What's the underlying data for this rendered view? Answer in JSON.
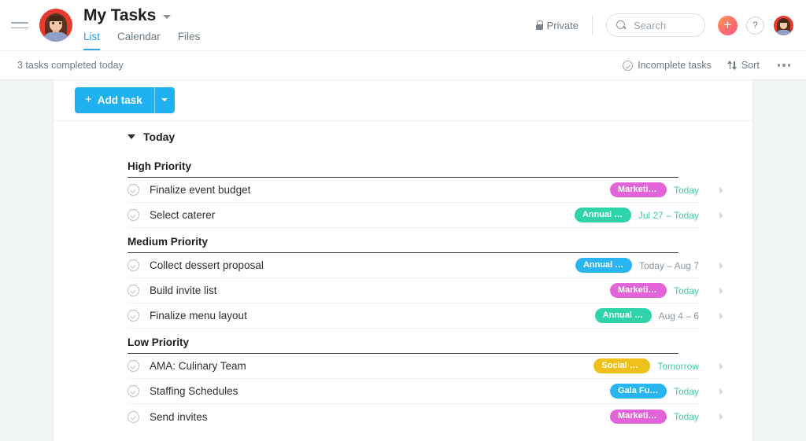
{
  "header": {
    "menu_icon": "hamburger-icon",
    "project_avatar": "project-avatar",
    "title": "My Tasks",
    "title_caret": "chevron-down-icon",
    "tabs": [
      {
        "label": "List",
        "active": true
      },
      {
        "label": "Calendar",
        "active": false
      },
      {
        "label": "Files",
        "active": false
      }
    ],
    "privacy": {
      "label": "Private",
      "icon": "lock-icon"
    },
    "search": {
      "placeholder": "Search",
      "value": "",
      "icon": "search-icon"
    },
    "add_button": {
      "label": "+",
      "icon": "plus-icon"
    },
    "help_button": {
      "label": "?",
      "icon": "question-mark-icon"
    },
    "user_avatar": "user-avatar"
  },
  "toolbar": {
    "completed_note": "3 tasks completed today",
    "filter": {
      "label": "Incomplete tasks",
      "icon": "check-circle-icon"
    },
    "sort": {
      "label": "Sort",
      "icon": "sort-arrows-icon"
    },
    "more": {
      "label": "•••",
      "icon": "more-horizontal-icon"
    }
  },
  "main": {
    "add_task": {
      "label": "Add task",
      "plus": "+",
      "dropdown_icon": "chevron-down-icon"
    },
    "group": {
      "label": "Today",
      "expanded": true,
      "toggle_icon": "triangle-down-icon"
    },
    "sections": [
      {
        "title": "High Priority",
        "tasks": [
          {
            "name": "Finalize event budget",
            "tag": "Marketin...",
            "tag_color": "#e364d8",
            "date": "Today",
            "date_color": "#3fd0a0"
          },
          {
            "name": "Select caterer",
            "tag": "Annual cu...",
            "tag_color": "#2ed3aa",
            "date": "Jul 27 – Today",
            "date_color": "#3fd0a0"
          }
        ]
      },
      {
        "title": "Medium Priority",
        "tasks": [
          {
            "name": "Collect dessert proposal",
            "tag": "Annual c...",
            "tag_color": "#29b6f0",
            "date": "Today – Aug 7",
            "date_color": "#8d969e"
          },
          {
            "name": "Build invite list",
            "tag": "Marketin...",
            "tag_color": "#e364d8",
            "date": "Today",
            "date_color": "#3fd0a0"
          },
          {
            "name": "Finalize menu layout",
            "tag": "Annual cu...",
            "tag_color": "#2ed3aa",
            "date": "Aug 4 – 6",
            "date_color": "#8d969e"
          }
        ]
      },
      {
        "title": "Low Priority",
        "tasks": [
          {
            "name": "AMA: Culinary Team",
            "tag": "Social Me...",
            "tag_color": "#eec01a",
            "date": "Tomorrow",
            "date_color": "#3fd0a0"
          },
          {
            "name": "Staffing Schedules",
            "tag": "Gala Fun...",
            "tag_color": "#29b6f0",
            "date": "Today",
            "date_color": "#3fd0a0"
          },
          {
            "name": "Send invites",
            "tag": "Marketin...",
            "tag_color": "#e364d8",
            "date": "Today",
            "date_color": "#3fd0a0"
          }
        ]
      }
    ]
  },
  "theme": {
    "accent_blue": "#20b1f0",
    "tab_active": "#26a0e8",
    "page_bg": "#f1f4f5",
    "text_primary": "#1e1f21",
    "text_muted": "#6e7a82"
  }
}
